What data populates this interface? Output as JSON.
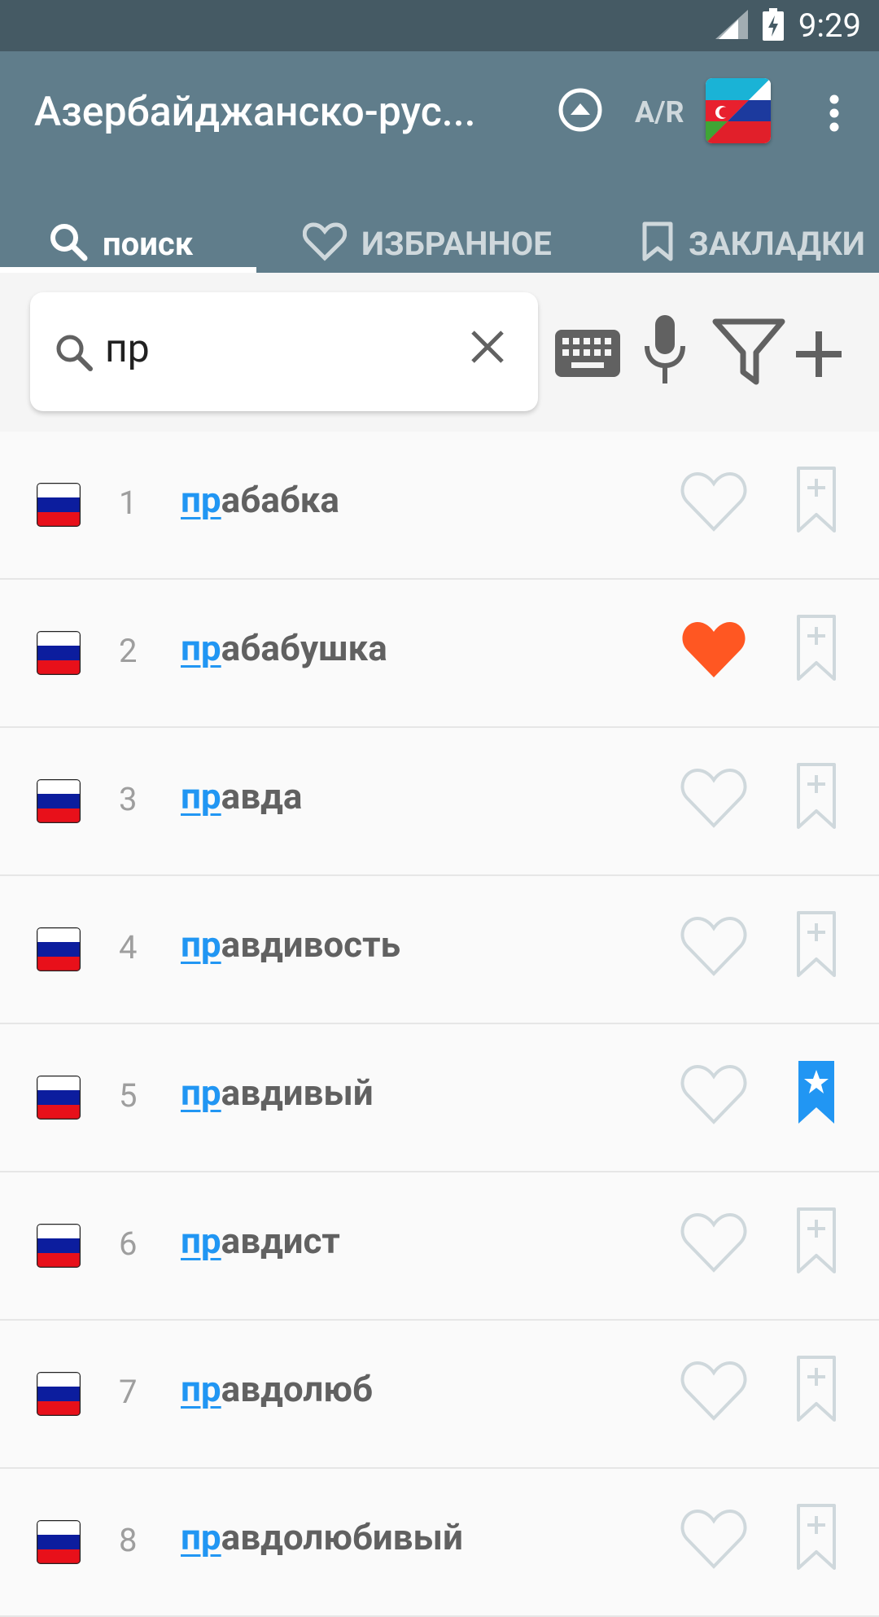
{
  "status_bar": {
    "time": "9:29"
  },
  "app_bar": {
    "title": "Азербайджанско-рус...",
    "direction_label": "A/R"
  },
  "tabs": [
    {
      "label": "поиск",
      "active": true
    },
    {
      "label": "ИЗБРАННОЕ",
      "active": false
    },
    {
      "label": "ЗАКЛАДКИ",
      "active": false
    }
  ],
  "search": {
    "query": "пр"
  },
  "results": [
    {
      "num": "1",
      "prefix": "пр",
      "rest": "абабка",
      "favorite": false,
      "bookmarked": false
    },
    {
      "num": "2",
      "prefix": "пр",
      "rest": "абабушка",
      "favorite": true,
      "bookmarked": false
    },
    {
      "num": "3",
      "prefix": "пр",
      "rest": "авда",
      "favorite": false,
      "bookmarked": false
    },
    {
      "num": "4",
      "prefix": "пр",
      "rest": "авдивость",
      "favorite": false,
      "bookmarked": false
    },
    {
      "num": "5",
      "prefix": "пр",
      "rest": "авдивый",
      "favorite": false,
      "bookmarked": true
    },
    {
      "num": "6",
      "prefix": "пр",
      "rest": "авдист",
      "favorite": false,
      "bookmarked": false
    },
    {
      "num": "7",
      "prefix": "пр",
      "rest": "авдолюб",
      "favorite": false,
      "bookmarked": false
    },
    {
      "num": "8",
      "prefix": "пр",
      "rest": "авдолюбивый",
      "favorite": false,
      "bookmarked": false
    }
  ],
  "colors": {
    "app_bar": "#607d8b",
    "status_bar": "#455a64",
    "highlight": "#2196f3",
    "favorite_active": "#ff5722",
    "bookmark_active": "#2196f3"
  }
}
